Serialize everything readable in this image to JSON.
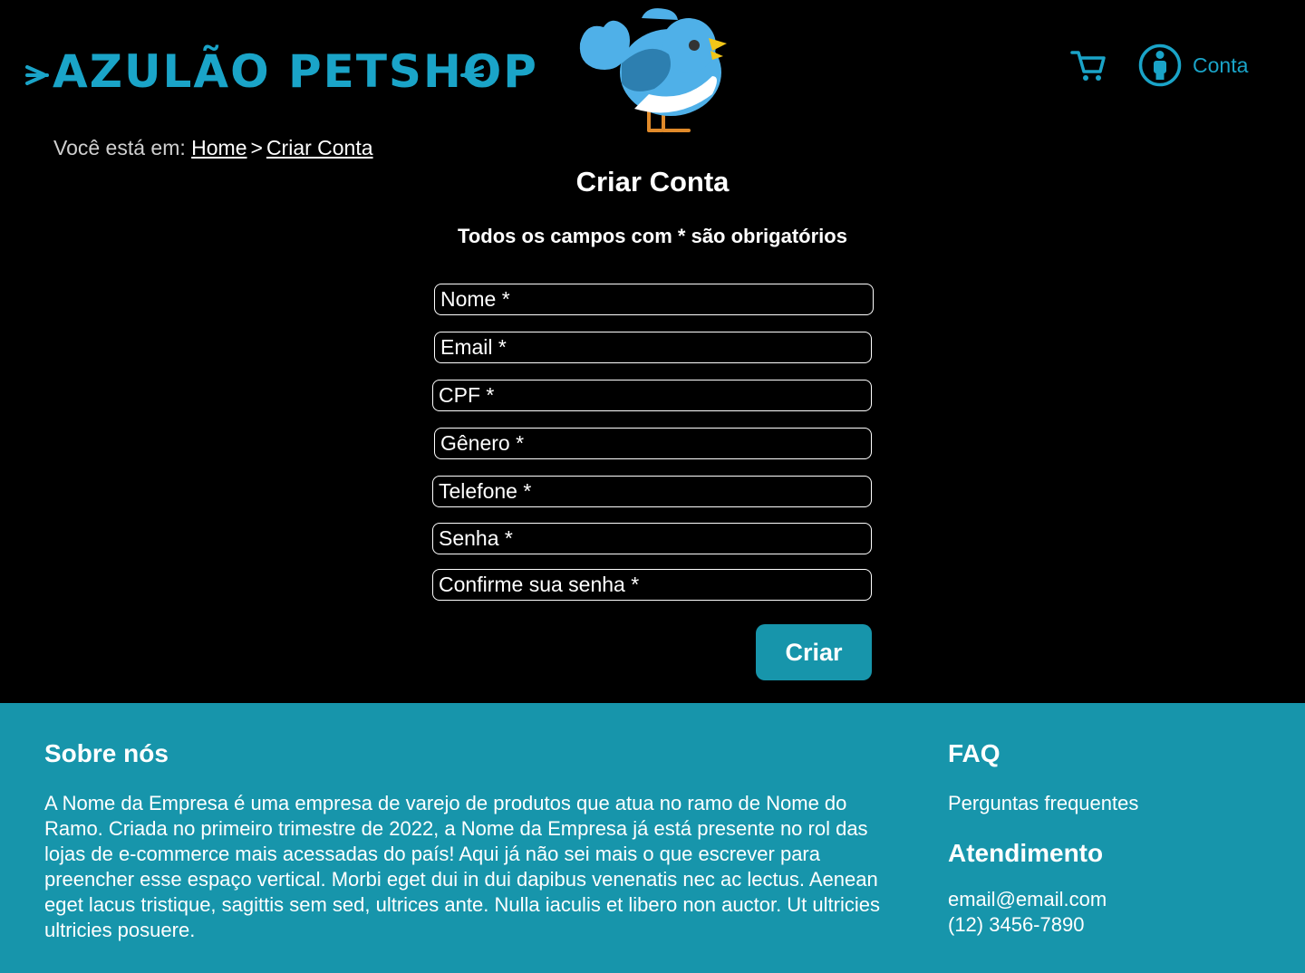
{
  "header": {
    "brand": "AZULÃO PETSHOP",
    "cart_label": "",
    "account_label": "Conta",
    "accent_color": "#1aa4c8"
  },
  "breadcrumb": {
    "prefix": "Você está em:",
    "items": [
      "Home",
      "Criar Conta"
    ],
    "separator": ">"
  },
  "main": {
    "title": "Criar Conta",
    "required_note": "Todos os campos com * são obrigatórios",
    "fields": [
      {
        "placeholder": "Nome *"
      },
      {
        "placeholder": "Email *"
      },
      {
        "placeholder": "CPF *"
      },
      {
        "placeholder": "Gênero *"
      },
      {
        "placeholder": "Telefone *"
      },
      {
        "placeholder": "Senha *"
      },
      {
        "placeholder": "Confirme sua senha *"
      }
    ],
    "submit_label": "Criar",
    "button_color": "#1795ab"
  },
  "footer": {
    "background": "#1795ab",
    "about_title": "Sobre nós",
    "about_text": "A Nome da Empresa é uma empresa de varejo de produtos que atua no ramo de Nome do Ramo. Criada no primeiro trimestre de 2022, a Nome da Empresa já está presente no rol das  lojas de e-commerce mais acessadas do país! Aqui já não sei mais o que escrever para preencher esse espaço vertical. Morbi eget dui in dui dapibus venenatis nec ac lectus. Aenean eget lacus tristique, sagittis sem sed, ultrices ante. Nulla iaculis et libero non auctor. Ut ultricies ultricies posuere.",
    "faq_title": "FAQ",
    "faq_link": "Perguntas frequentes",
    "support_title": "Atendimento",
    "support_email": "email@email.com",
    "support_phone": "(12) 3456-7890"
  },
  "icons": [
    "bird-logo-icon",
    "cart-icon",
    "user-icon"
  ]
}
